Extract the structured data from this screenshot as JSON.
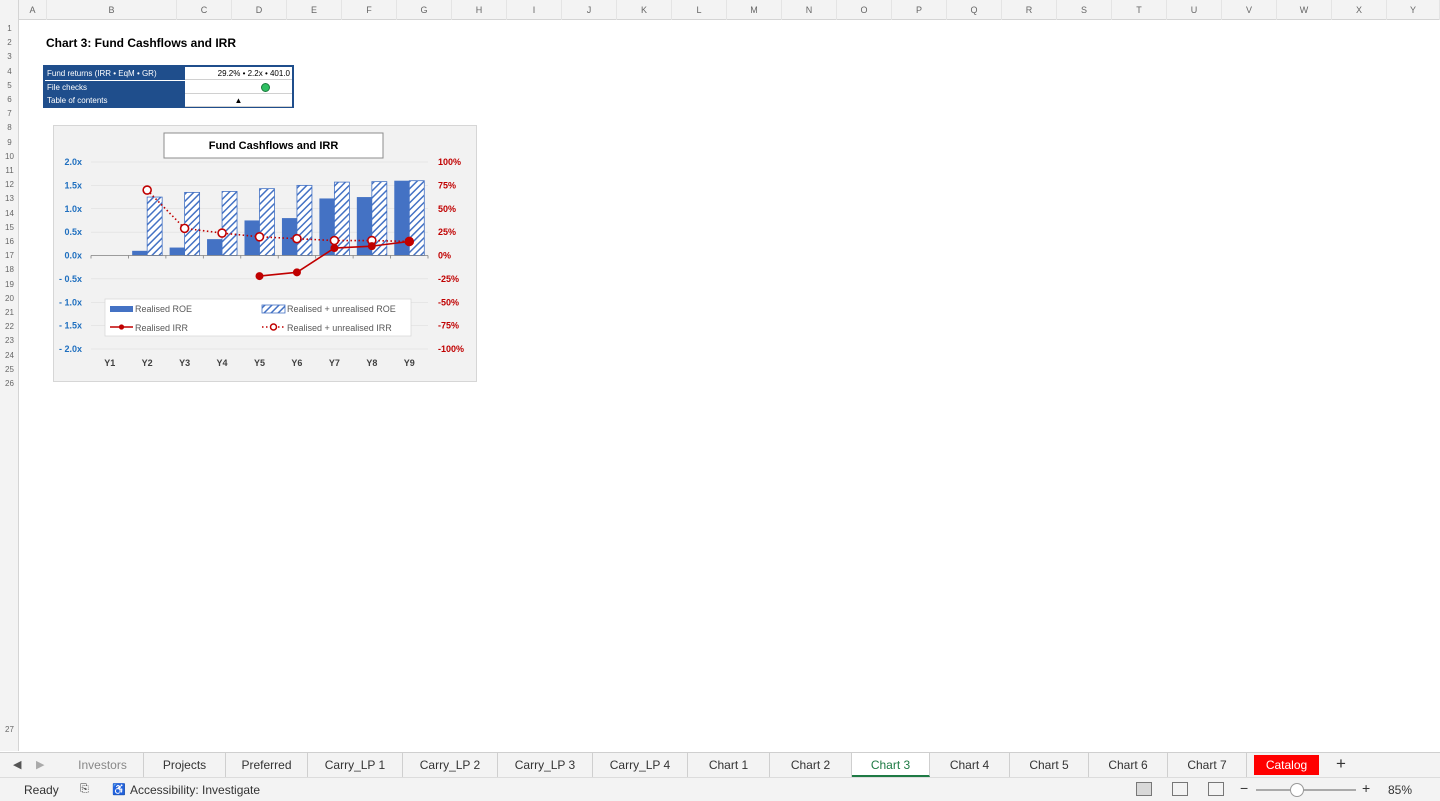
{
  "columns": [
    "A",
    "B",
    "C",
    "D",
    "E",
    "F",
    "G",
    "H",
    "I",
    "J",
    "K",
    "L",
    "M",
    "N",
    "O",
    "P",
    "Q",
    "R",
    "S",
    "T",
    "U",
    "V",
    "W",
    "X",
    "Y"
  ],
  "rows": [
    "1",
    "2",
    "3",
    "4",
    "5",
    "6",
    "7",
    "8",
    "9",
    "10",
    "11",
    "12",
    "13",
    "14",
    "15",
    "16",
    "17",
    "18",
    "19",
    "20",
    "21",
    "22",
    "23",
    "24",
    "25",
    "26",
    "27"
  ],
  "sheet": {
    "title": "Chart 3: Fund Cashflows and IRR",
    "info": [
      {
        "label": "Fund returns (IRR • EqM • GR)",
        "value": "29.2% • 2.2x • 401.0"
      },
      {
        "label": "File checks",
        "value": ""
      },
      {
        "label": "Table of contents",
        "value": "▲"
      }
    ],
    "file_check_color": "#2fbf62"
  },
  "chart_data": {
    "type": "bar",
    "title": "Fund Cashflows and IRR",
    "categories": [
      "Y1",
      "Y2",
      "Y3",
      "Y4",
      "Y5",
      "Y6",
      "Y7",
      "Y8",
      "Y9"
    ],
    "left_axis": {
      "ticks": [
        "2.0x",
        "1.5x",
        "1.0x",
        "0.5x",
        "0.0x",
        "- 0.5x",
        "- 1.0x",
        "- 1.5x",
        "- 2.0x"
      ],
      "ylim": [
        -2.0,
        2.0
      ],
      "color": "#1f6fbf"
    },
    "right_axis": {
      "ticks": [
        "100%",
        "75%",
        "50%",
        "25%",
        "0%",
        "-25%",
        "-50%",
        "-75%",
        "-100%"
      ],
      "ylim": [
        -100,
        100
      ],
      "color": "#c00000"
    },
    "series": [
      {
        "name": "Realised ROE",
        "kind": "bar",
        "color": "#4472c4",
        "values": [
          0.0,
          0.1,
          0.17,
          0.35,
          0.75,
          0.8,
          1.22,
          1.25,
          1.6
        ]
      },
      {
        "name": "Realised + unrealised ROE",
        "kind": "bar-hatched",
        "color": "#4472c4",
        "values": [
          0.0,
          1.25,
          1.35,
          1.37,
          1.43,
          1.5,
          1.57,
          1.58,
          1.6
        ]
      },
      {
        "name": "Realised IRR",
        "kind": "line",
        "color": "#c00000",
        "values": [
          null,
          null,
          null,
          null,
          -22,
          -18,
          8,
          10,
          15
        ]
      },
      {
        "name": "Realised + unrealised IRR",
        "kind": "line-dotted",
        "color": "#c00000",
        "values": [
          null,
          70,
          29,
          24,
          20,
          18,
          16,
          16,
          15
        ]
      }
    ],
    "legend": "bottom-left inside",
    "grid": true
  },
  "tabs": [
    {
      "label": "Investors"
    },
    {
      "label": "Projects"
    },
    {
      "label": "Preferred"
    },
    {
      "label": "Carry_LP 1"
    },
    {
      "label": "Carry_LP 2"
    },
    {
      "label": "Carry_LP 3"
    },
    {
      "label": "Carry_LP 4"
    },
    {
      "label": "Chart 1"
    },
    {
      "label": "Chart 2"
    },
    {
      "label": "Chart 3"
    },
    {
      "label": "Chart 4"
    },
    {
      "label": "Chart 5"
    },
    {
      "label": "Chart 6"
    },
    {
      "label": "Chart 7"
    },
    {
      "label": "Catalog"
    }
  ],
  "active_tab": "Chart 3",
  "status": {
    "ready": "Ready",
    "accessibility": "Accessibility: Investigate",
    "zoom": "85%"
  },
  "icons": {
    "prev": "◀",
    "next": "▶",
    "add": "+",
    "zoom_minus": "−",
    "zoom_plus": "+"
  }
}
